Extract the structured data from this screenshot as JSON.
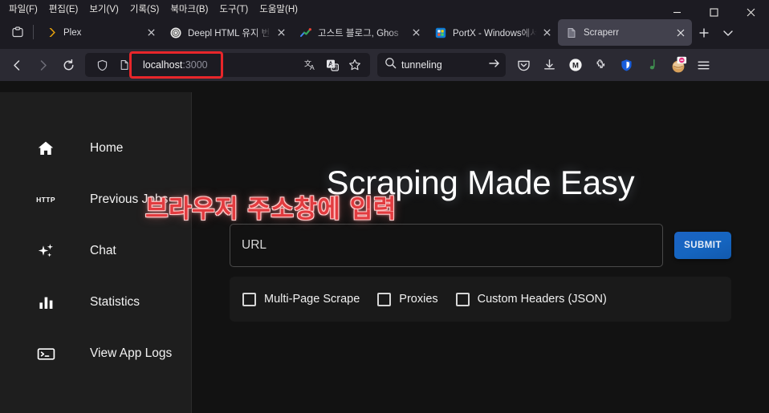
{
  "browser": {
    "menu": [
      {
        "label": "파일(F)"
      },
      {
        "label": "편집(E)"
      },
      {
        "label": "보기(V)"
      },
      {
        "label": "기록(S)"
      },
      {
        "label": "북마크(B)"
      },
      {
        "label": "도구(T)"
      },
      {
        "label": "도움말(H)"
      }
    ],
    "window_controls": {
      "minimize": "minimize",
      "maximize": "maximize",
      "close": "close"
    },
    "tabs": [
      {
        "title": "Plex",
        "favicon": "plex-icon",
        "active": false
      },
      {
        "title": "Deepl HTML 유지 번",
        "favicon": "chatgpt-icon",
        "active": false
      },
      {
        "title": "고스트 블로그, Ghos",
        "favicon": "chart-icon",
        "active": false
      },
      {
        "title": "PortX - Windows에서",
        "favicon": "microsoft-store-icon",
        "active": false
      },
      {
        "title": "Scraperr",
        "favicon": "document-icon",
        "active": true
      }
    ],
    "tab_actions": {
      "list_all_tabs": "list-all-tabs",
      "new_tab": "new-tab",
      "tab_overview": "tab-overview"
    },
    "nav": {
      "back": "back",
      "forward": "forward",
      "reload": "reload"
    },
    "address_bar": {
      "host": "localhost",
      "port": ":3000",
      "shield_icon": "shield-icon",
      "page_icon": "page-icon",
      "translate_icon": "translate-icon",
      "translate_alt_icon": "translate-alt-icon",
      "bookmark_icon": "star-icon",
      "annotation_color": "#e8262a"
    },
    "search_bar": {
      "value": "tunneling",
      "search_icon": "search-icon",
      "go_icon": "arrow-right-icon"
    },
    "toolbar_extensions": [
      {
        "name": "pocket-icon"
      },
      {
        "name": "downloads-icon"
      },
      {
        "name": "metamask-icon"
      },
      {
        "name": "extension-puzzle-icon"
      },
      {
        "name": "bitwarden-shield-icon"
      },
      {
        "name": "note-icon"
      },
      {
        "name": "profile-avatar-icon"
      },
      {
        "name": "app-menu-icon"
      }
    ]
  },
  "annotation": {
    "text": "브라우저 주소창에 입력",
    "color": "#e23b3f"
  },
  "sidebar": {
    "items": [
      {
        "label": "Home",
        "icon": "home-icon"
      },
      {
        "label": "Previous Jobs",
        "icon": "http-icon"
      },
      {
        "label": "Chat",
        "icon": "sparkles-icon"
      },
      {
        "label": "Statistics",
        "icon": "bar-chart-icon"
      },
      {
        "label": "View App Logs",
        "icon": "terminal-icon"
      }
    ]
  },
  "main": {
    "title": "Scraping Made Easy",
    "url_input": {
      "label": "URL",
      "value": ""
    },
    "submit_label": "SUBMIT",
    "submit_color": "#1565c0",
    "options": [
      {
        "label": "Multi-Page Scrape",
        "checked": false
      },
      {
        "label": "Proxies",
        "checked": false
      },
      {
        "label": "Custom Headers (JSON)",
        "checked": false
      }
    ]
  }
}
